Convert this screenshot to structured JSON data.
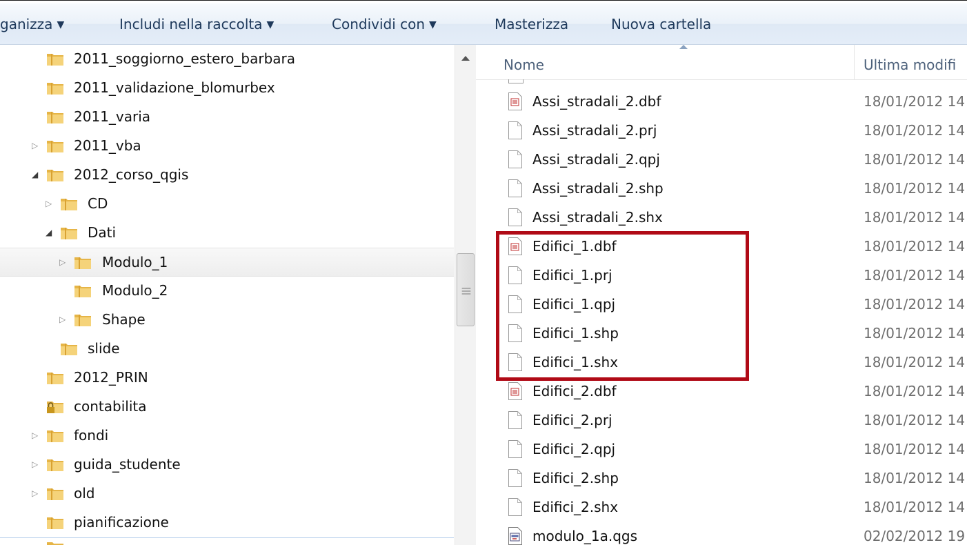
{
  "toolbar": {
    "organize": "ganizza",
    "include": "Includi nella raccolta",
    "share": "Condividi con",
    "burn": "Masterizza",
    "new_folder": "Nuova cartella",
    "dropdown_glyph": "▼"
  },
  "nav_tree": {
    "items": [
      {
        "label": "2011_soggiorno_estero_barbara",
        "expander": "",
        "icon": "folder-icon"
      },
      {
        "label": "2011_validazione_blomurbex",
        "expander": "",
        "icon": "folder-icon"
      },
      {
        "label": "2011_varia",
        "expander": "",
        "icon": "folder-icon"
      },
      {
        "label": "2011_vba",
        "expander": "▷",
        "icon": "folder-icon"
      },
      {
        "label": "2012_corso_qgis",
        "expander": "◢",
        "icon": "folder-icon"
      },
      {
        "label": "CD",
        "expander": "▷",
        "icon": "folder-icon"
      },
      {
        "label": "Dati",
        "expander": "◢",
        "icon": "folder-icon"
      },
      {
        "label": "Modulo_1",
        "expander": "▷",
        "icon": "folder-icon",
        "selected": true
      },
      {
        "label": "Modulo_2",
        "expander": "",
        "icon": "folder-icon"
      },
      {
        "label": "Shape",
        "expander": "▷",
        "icon": "folder-icon"
      },
      {
        "label": "slide",
        "expander": "",
        "icon": "folder-icon"
      },
      {
        "label": "2012_PRIN",
        "expander": "",
        "icon": "folder-icon"
      },
      {
        "label": "contabilita",
        "expander": "",
        "icon": "locked-folder-icon"
      },
      {
        "label": "fondi",
        "expander": "▷",
        "icon": "folder-icon"
      },
      {
        "label": "guida_studente",
        "expander": "▷",
        "icon": "folder-icon"
      },
      {
        "label": "old",
        "expander": "▷",
        "icon": "folder-icon"
      },
      {
        "label": "pianificazione",
        "expander": "",
        "icon": "folder-icon"
      }
    ]
  },
  "file_list": {
    "columns": {
      "name": "Nome",
      "date": "Ultima modifi"
    },
    "files": [
      {
        "name": "Assi_stradali_2.dbf",
        "date": "18/01/2012 14",
        "icon": "dbf-file-icon"
      },
      {
        "name": "Assi_stradali_2.prj",
        "date": "18/01/2012 14",
        "icon": "generic-file-icon"
      },
      {
        "name": "Assi_stradali_2.qpj",
        "date": "18/01/2012 14",
        "icon": "generic-file-icon"
      },
      {
        "name": "Assi_stradali_2.shp",
        "date": "18/01/2012 14",
        "icon": "generic-file-icon"
      },
      {
        "name": "Assi_stradali_2.shx",
        "date": "18/01/2012 14",
        "icon": "generic-file-icon"
      },
      {
        "name": "Edifici_1.dbf",
        "date": "18/01/2012 14",
        "icon": "dbf-file-icon"
      },
      {
        "name": "Edifici_1.prj",
        "date": "18/01/2012 14",
        "icon": "generic-file-icon"
      },
      {
        "name": "Edifici_1.qpj",
        "date": "18/01/2012 14",
        "icon": "generic-file-icon"
      },
      {
        "name": "Edifici_1.shp",
        "date": "18/01/2012 14",
        "icon": "generic-file-icon"
      },
      {
        "name": "Edifici_1.shx",
        "date": "18/01/2012 14",
        "icon": "generic-file-icon"
      },
      {
        "name": "Edifici_2.dbf",
        "date": "18/01/2012 14",
        "icon": "dbf-file-icon"
      },
      {
        "name": "Edifici_2.prj",
        "date": "18/01/2012 14",
        "icon": "generic-file-icon"
      },
      {
        "name": "Edifici_2.qpj",
        "date": "18/01/2012 14",
        "icon": "generic-file-icon"
      },
      {
        "name": "Edifici_2.shp",
        "date": "18/01/2012 14",
        "icon": "generic-file-icon"
      },
      {
        "name": "Edifici_2.shx",
        "date": "18/01/2012 14",
        "icon": "generic-file-icon"
      },
      {
        "name": "modulo_1a.qgs",
        "date": "02/02/2012 19",
        "icon": "qgs-file-icon"
      }
    ]
  },
  "colors": {
    "highlight_box": "#b00a16",
    "folder": "#e8b84a",
    "toolbar_text": "#1e395b"
  }
}
